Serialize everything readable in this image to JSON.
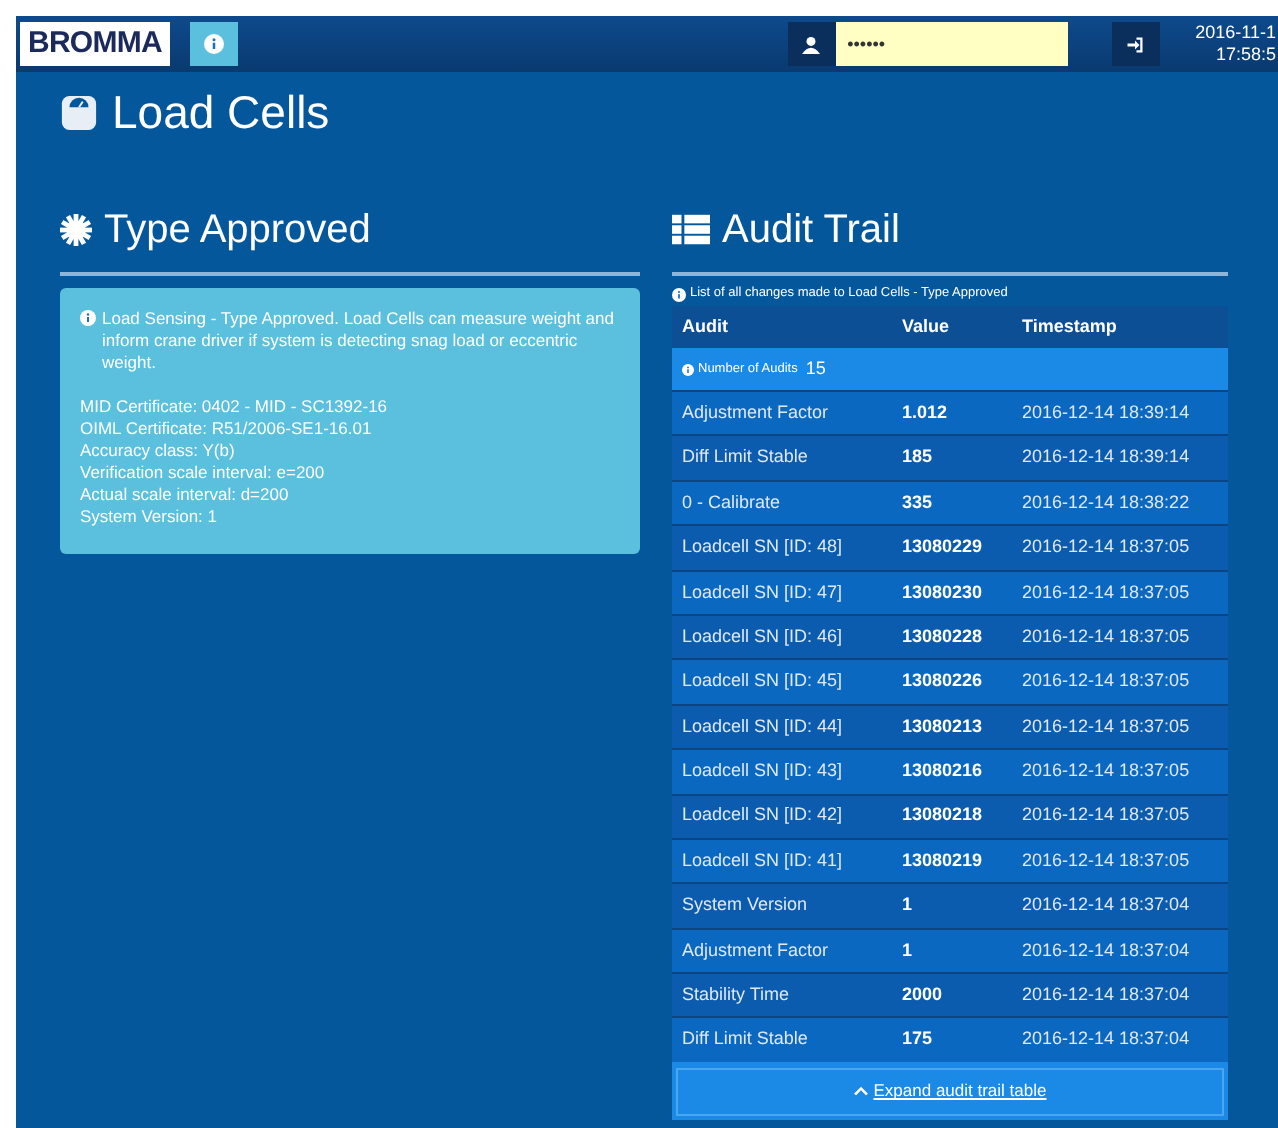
{
  "navbar": {
    "logo": "BROMMA",
    "password": {
      "value": "••••••"
    },
    "datetime": [
      "2016-11-1",
      "17:58:5"
    ]
  },
  "page_title": "Load Cells",
  "type_approved": {
    "heading": "Type Approved",
    "description": "Load Sensing - Type Approved. Load Cells can measure weight and inform crane driver if system is detecting snag load or eccentric weight.",
    "details": [
      "MID Certificate: 0402 - MID - SC1392-16",
      "OIML Certificate: R51/2006-SE1-16.01",
      "Accuracy class: Y(b)",
      "Verification scale interval: e=200",
      "Actual scale interval: d=200",
      "System Version: 1"
    ]
  },
  "audit_trail": {
    "heading": "Audit Trail",
    "caption": "List of all changes made to Load Cells - Type Approved",
    "columns": [
      "Audit",
      "Value",
      "Timestamp"
    ],
    "count_label": "Number of Audits",
    "count": "15",
    "rows": [
      {
        "audit": "Adjustment Factor",
        "value": "1.012",
        "timestamp": "2016-12-14 18:39:14"
      },
      {
        "audit": "Diff Limit Stable",
        "value": "185",
        "timestamp": "2016-12-14 18:39:14"
      },
      {
        "audit": "0 - Calibrate",
        "value": "335",
        "timestamp": "2016-12-14 18:38:22"
      },
      {
        "audit": "Loadcell SN [ID: 48]",
        "value": "13080229",
        "timestamp": "2016-12-14 18:37:05"
      },
      {
        "audit": "Loadcell SN [ID: 47]",
        "value": "13080230",
        "timestamp": "2016-12-14 18:37:05"
      },
      {
        "audit": "Loadcell SN [ID: 46]",
        "value": "13080228",
        "timestamp": "2016-12-14 18:37:05"
      },
      {
        "audit": "Loadcell SN [ID: 45]",
        "value": "13080226",
        "timestamp": "2016-12-14 18:37:05"
      },
      {
        "audit": "Loadcell SN [ID: 44]",
        "value": "13080213",
        "timestamp": "2016-12-14 18:37:05"
      },
      {
        "audit": "Loadcell SN [ID: 43]",
        "value": "13080216",
        "timestamp": "2016-12-14 18:37:05"
      },
      {
        "audit": "Loadcell SN [ID: 42]",
        "value": "13080218",
        "timestamp": "2016-12-14 18:37:05"
      },
      {
        "audit": "Loadcell SN [ID: 41]",
        "value": "13080219",
        "timestamp": "2016-12-14 18:37:05"
      },
      {
        "audit": "System Version",
        "value": "1",
        "timestamp": "2016-12-14 18:37:04"
      },
      {
        "audit": "Adjustment Factor",
        "value": "1",
        "timestamp": "2016-12-14 18:37:04"
      },
      {
        "audit": "Stability Time",
        "value": "2000",
        "timestamp": "2016-12-14 18:37:04"
      },
      {
        "audit": "Diff Limit Stable",
        "value": "175",
        "timestamp": "2016-12-14 18:37:04"
      }
    ],
    "expand_button": "Expand audit trail table"
  }
}
